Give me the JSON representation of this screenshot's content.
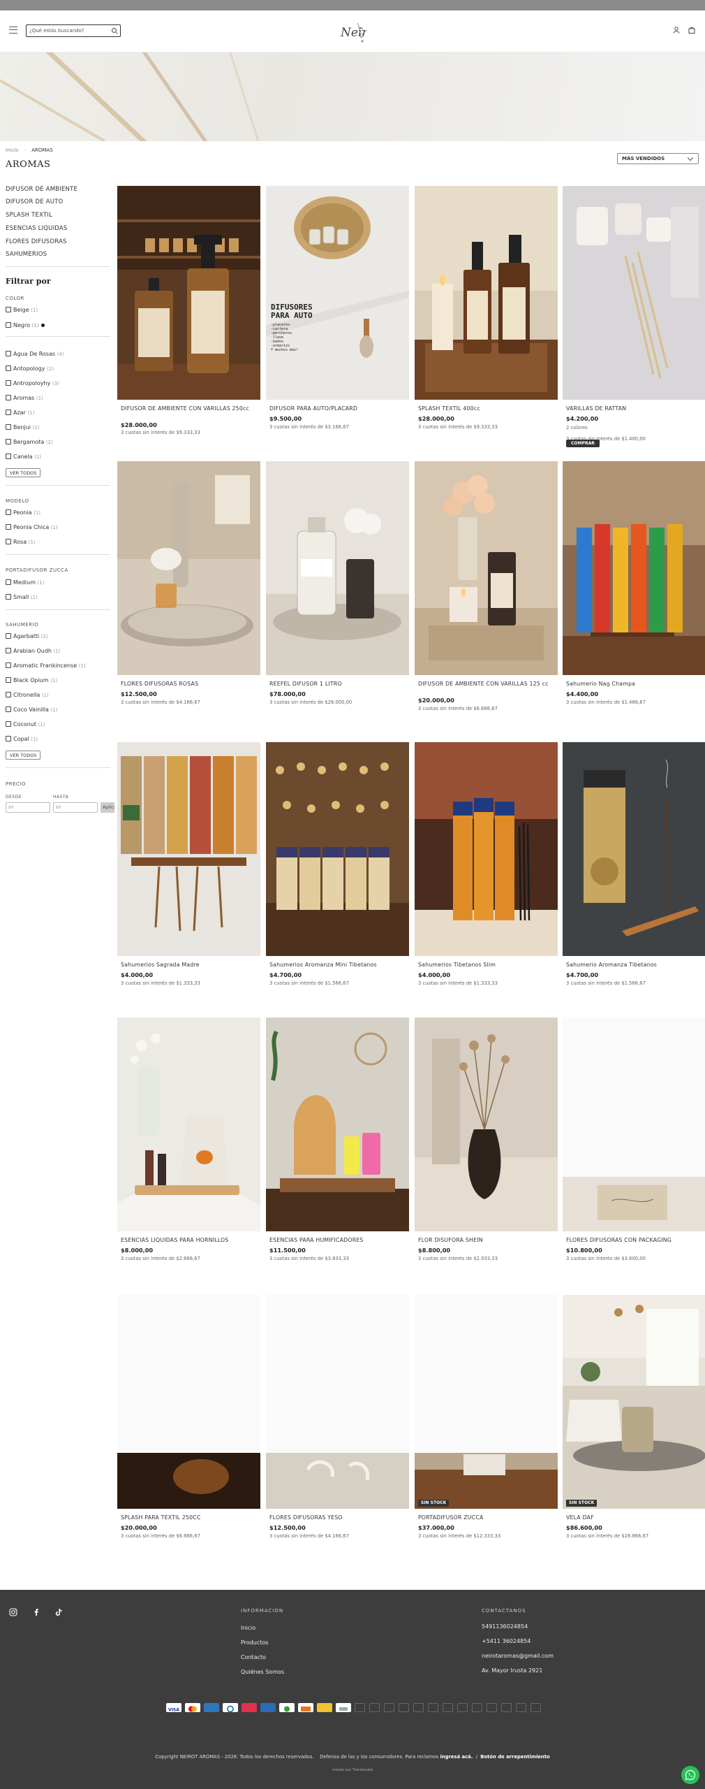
{
  "header": {
    "search_placeholder": "¿Qué estás buscando?",
    "menu_icon": "hamburger-menu-icon",
    "user_icon": "user-icon",
    "cart_icon": "shopping-bag-icon"
  },
  "breadcrumb": {
    "home": "Inicio",
    "current": "AROMAS"
  },
  "page_title": "AROMAS",
  "sort": {
    "selected": "MÁS VENDIDOS"
  },
  "categories": [
    "DIFUSOR DE AMBIENTE",
    "DIFUSOR DE AUTO",
    "SPLASH TEXTIL",
    "ESENCIAS LIQUIDAS",
    "FLORES DIFUSORAS",
    "SAHUMERIOS"
  ],
  "filters": {
    "title": "Filtrar por",
    "color": {
      "label": "COLOR",
      "options": [
        {
          "name": "Beige",
          "count": "(1)"
        },
        {
          "name": "Negro",
          "count": "(1)"
        }
      ]
    },
    "aroma": {
      "options": [
        {
          "name": "Agua De Rosas",
          "count": "(4)"
        },
        {
          "name": "Antopology",
          "count": "(1)"
        },
        {
          "name": "Antropoloyhy",
          "count": "(3)"
        },
        {
          "name": "Aromas",
          "count": "(1)"
        },
        {
          "name": "Azar",
          "count": "(1)"
        },
        {
          "name": "Benjui",
          "count": "(1)"
        },
        {
          "name": "Bergamota",
          "count": "(2)"
        },
        {
          "name": "Canela",
          "count": "(1)"
        }
      ],
      "see_all": "VER TODOS"
    },
    "modelo": {
      "label": "MODELO",
      "options": [
        {
          "name": "Peonia",
          "count": "(1)"
        },
        {
          "name": "Peonia Chica",
          "count": "(1)"
        },
        {
          "name": "Rosa",
          "count": "(1)"
        }
      ]
    },
    "portadifusor": {
      "label": "PORTADIFUSOR ZUCCA",
      "options": [
        {
          "name": "Medium",
          "count": "(1)"
        },
        {
          "name": "Small",
          "count": "(1)"
        }
      ]
    },
    "sahumerio": {
      "label": "SAHUMERIO",
      "options": [
        {
          "name": "Agarbatti",
          "count": "(1)"
        },
        {
          "name": "Arabian Oudh",
          "count": "(1)"
        },
        {
          "name": "Aromatic Frankincense",
          "count": "(1)"
        },
        {
          "name": "Black Opium",
          "count": "(1)"
        },
        {
          "name": "Citronella",
          "count": "(1)"
        },
        {
          "name": "Coco Vainilla",
          "count": "(1)"
        },
        {
          "name": "Coconut",
          "count": "(1)"
        },
        {
          "name": "Copal",
          "count": "(1)"
        }
      ],
      "see_all": "VER TODOS"
    },
    "precio": {
      "label": "PRECIO",
      "from_label": "DESDE",
      "to_label": "HASTA",
      "from_placeholder": "$0",
      "to_placeholder": "$0",
      "apply": "Aplicar"
    }
  },
  "products": [
    {
      "name": "DIFUSOR DE AMBIENTE CON VARILLAS 250cc",
      "price": "$28.000,00",
      "installments": "3 cuotas sin interés de $9.333,33"
    },
    {
      "name": "DIFUSOR PARA AUTO/PLACARD",
      "price": "$9.500,00",
      "installments": "3 cuotas sin interés de $3.166,67",
      "image_text": [
        "DIFUSORES",
        "PARA AUTO",
        "-placares",
        "-cartera",
        "-percheros",
        "-llave",
        "-baños",
        "-armarios",
        "Y muchos más!"
      ]
    },
    {
      "name": "SPLASH TEXTIL 400cc",
      "price": "$28.000,00",
      "installments": "3 cuotas sin interés de $9.333,33"
    },
    {
      "name": "VARILLAS DE RATTAN",
      "price": "$4.200,00",
      "colors": "2 colores",
      "installments": "3 cuotas sin interés de $1.400,00",
      "buy": "COMPRAR"
    },
    {
      "name": "FLORES DIFUSORAS ROSAS",
      "price": "$12.500,00",
      "installments": "3 cuotas sin interés de $4.166,67"
    },
    {
      "name": "REEFEL DIFUSOR 1 LITRO",
      "price": "$78.000,00",
      "installments": "3 cuotas sin interés de $26.000,00"
    },
    {
      "name": "DIFUSOR DE AMBIENTE CON VARILLAS 125 cc",
      "price": "$20.000,00",
      "installments": "3 cuotas sin interés de $6.666,67"
    },
    {
      "name": "Sahumerio Nag Champa",
      "price": "$4.400,00",
      "installments": "3 cuotas sin interés de $1.466,67"
    },
    {
      "name": "Sahumerios Sagrada Madre",
      "price": "$4.000,00",
      "installments": "3 cuotas sin interés de $1.333,33"
    },
    {
      "name": "Sahumerios Aromanza Mini Tibetanos",
      "price": "$4.700,00",
      "installments": "3 cuotas sin interés de $1.566,67"
    },
    {
      "name": "Sahumerios Tibetanos Slim",
      "price": "$4.000,00",
      "installments": "3 cuotas sin interés de $1.333,33"
    },
    {
      "name": "Sahumerio Aromanza Tibetanos",
      "price": "$4.700,00",
      "installments": "3 cuotas sin interés de $1.566,67"
    },
    {
      "name": "ESENCIAS LIQUIDAS PARA HORNILLOS",
      "price": "$8.000,00",
      "installments": "3 cuotas sin interés de $2.666,67"
    },
    {
      "name": "ESENCIAS PARA HUMIFICADORES",
      "price": "$11.500,00",
      "installments": "3 cuotas sin interés de $3.833,33"
    },
    {
      "name": "FLOR DISUFORA SHEIN",
      "price": "$8.800,00",
      "installments": "3 cuotas sin interés de $2.933,33"
    },
    {
      "name": "FLORES DIFUSORAS CON PACKAGING",
      "price": "$10.800,00",
      "installments": "3 cuotas sin interés de $3.600,00"
    },
    {
      "name": "SPLASH PARA TEXTIL 250CC",
      "price": "$20.000,00",
      "installments": "3 cuotas sin interés de $6.666,67"
    },
    {
      "name": "FLORES DIFUSORAS YESO",
      "price": "$12.500,00",
      "installments": "3 cuotas sin interés de $4.166,67"
    },
    {
      "name": "PORTADIFUSOR ZUCCA",
      "price": "$37.000,00",
      "installments": "3 cuotas sin interés de $12.333,33",
      "badge": "SIN STOCK"
    },
    {
      "name": "VELA DAF",
      "price": "$86.600,00",
      "installments": "3 cuotas sin interés de $28.866,67",
      "badge": "SIN STOCK"
    }
  ],
  "footer": {
    "social_icons": [
      "instagram-icon",
      "facebook-icon",
      "tiktok-icon"
    ],
    "info_title": "INFORMACION",
    "info_links": [
      "Inicio",
      "Productos",
      "Contacto",
      "Quiénes Somos"
    ],
    "contact_title": "CONTACTANOS",
    "contact": [
      "5491136024854",
      "+5411 36024854",
      "neirotaromas@gmail.com",
      "Av. Mayor Irusta 2921"
    ],
    "copyright": "Copyright NEIROT AROMAS - 2026. Todos los derechos reservados.",
    "consumer": "Defensa de las y los consumidores. Para reclamos",
    "consumer_link": "ingresá acá.",
    "regret": "Botón de arrepentimiento",
    "powered": "creado con Tiendanube"
  },
  "colors": {
    "footer_bg": "#3d3d3d",
    "whatsapp": "#27c05a",
    "topbar": "#8a8a8a"
  }
}
